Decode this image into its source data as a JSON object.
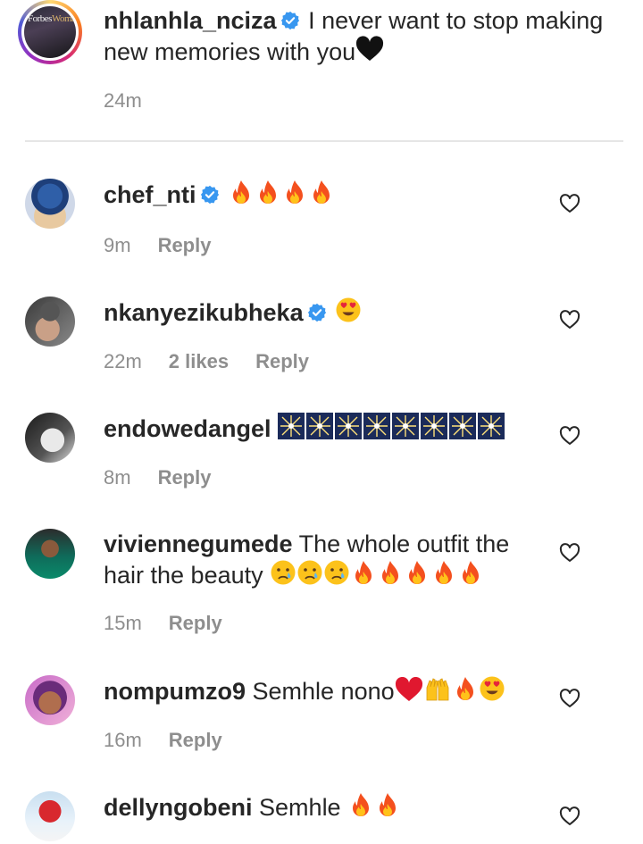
{
  "caption": {
    "username": "nhlanhla_nciza",
    "text": "I never want to stop making new memories with you",
    "trailing_emoji": "black-heart",
    "time": "24m",
    "avatar_text_a": "Forbes",
    "avatar_text_b": "Woman"
  },
  "comments": [
    {
      "username": "chef_nti",
      "verified": true,
      "text": "",
      "emojis": [
        "fire",
        "fire",
        "fire",
        "fire"
      ],
      "time": "9m",
      "likes": "",
      "reply": "Reply"
    },
    {
      "username": "nkanyezikubheka",
      "verified": true,
      "text": "",
      "emojis": [
        "heart-eyes"
      ],
      "time": "22m",
      "likes": "2 likes",
      "reply": "Reply"
    },
    {
      "username": "endowedangel",
      "verified": false,
      "text": "",
      "emojis": [
        "sparkler",
        "sparkler",
        "sparkler",
        "sparkler",
        "sparkler",
        "sparkler",
        "sparkler",
        "sparkler"
      ],
      "time": "8m",
      "likes": "",
      "reply": "Reply"
    },
    {
      "username": "viviennegumede",
      "verified": false,
      "text": "The whole outfit the hair the beauty",
      "emojis": [
        "crying",
        "crying",
        "crying",
        "fire",
        "fire",
        "fire",
        "fire",
        "fire"
      ],
      "time": "15m",
      "likes": "",
      "reply": "Reply"
    },
    {
      "username": "nompumzo9",
      "verified": false,
      "text": "Semhle nono",
      "emojis": [
        "red-heart",
        "raised-hands",
        "fire",
        "heart-eyes"
      ],
      "time": "16m",
      "likes": "",
      "reply": "Reply"
    },
    {
      "username": "dellyngobeni",
      "verified": false,
      "text": "Semhle",
      "emojis": [
        "fire",
        "fire"
      ],
      "time": "",
      "likes": "",
      "reply": ""
    }
  ],
  "colors": {
    "verified": "#3897f0",
    "secondary_text": "#8e8e8e",
    "primary_text": "#262626",
    "divider": "#e6e6e6"
  }
}
